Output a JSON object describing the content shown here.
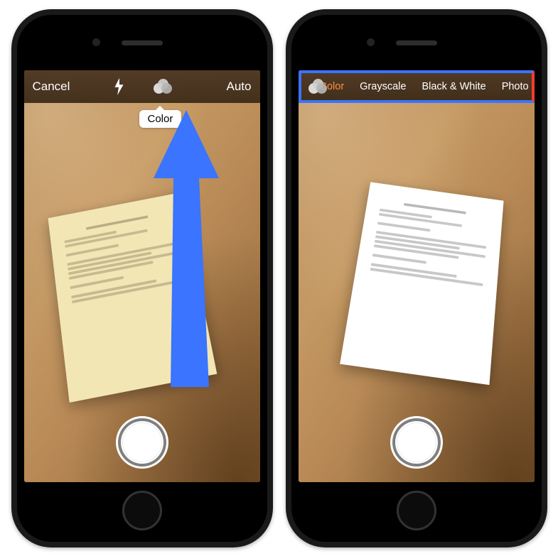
{
  "left": {
    "toolbar": {
      "cancel": "Cancel",
      "mode": "Auto"
    },
    "tooltip": "Color"
  },
  "right": {
    "modes": {
      "color": "Color",
      "grayscale": "Grayscale",
      "bw": "Black & White",
      "photo": "Photo"
    }
  },
  "icons": {
    "flash": "flash-icon",
    "filter": "filter-icon",
    "shutter": "shutter-button"
  },
  "annotation": {
    "arrow_color": "#3a74ff"
  }
}
